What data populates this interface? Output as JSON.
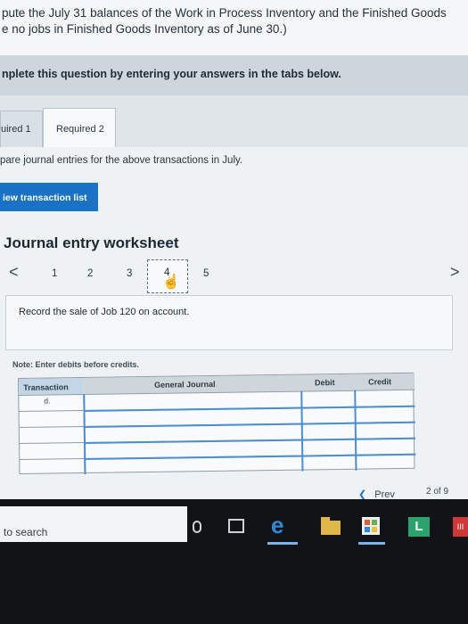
{
  "question": {
    "line1": "pute the July 31 balances of the Work in Process Inventory and the Finished Goods",
    "line2": "e no jobs in Finished Goods Inventory as of June 30.)"
  },
  "instructions": "nplete this question by entering your answers in the tabs below.",
  "tabs": [
    {
      "label": "uired 1"
    },
    {
      "label": "Required 2"
    }
  ],
  "prepare_text": "pare journal entries for the above transactions in July.",
  "view_transactions_button": "iew transaction list",
  "worksheet": {
    "title": "Journal entry worksheet",
    "prev_arrow": "<",
    "next_arrow": ">",
    "pages": [
      "1",
      "2",
      "3",
      "4",
      "5"
    ],
    "active_page": "4",
    "prompt": "Record the sale of Job 120 on account.",
    "note": "Note: Enter debits before credits.",
    "columns": {
      "transaction": "Transaction",
      "general_journal": "General Journal",
      "debit": "Debit",
      "credit": "Credit"
    },
    "rows": [
      {
        "transaction": "d.",
        "account": "",
        "debit": "",
        "credit": ""
      },
      {
        "transaction": "",
        "account": "",
        "debit": "",
        "credit": ""
      },
      {
        "transaction": "",
        "account": "",
        "debit": "",
        "credit": ""
      },
      {
        "transaction": "",
        "account": "",
        "debit": "",
        "credit": ""
      },
      {
        "transaction": "",
        "account": "",
        "debit": "",
        "credit": ""
      }
    ]
  },
  "footer": {
    "prev_label": "Prev",
    "page_indicator": "2 of 9"
  },
  "taskbar": {
    "search_text": "to search",
    "icons": [
      "microphone-icon",
      "task-view-icon",
      "edge-browser-icon",
      "file-explorer-icon",
      "store-icon",
      "app-l-icon",
      "app-red-icon"
    ],
    "edge_glyph": "e",
    "l_app_glyph": "L",
    "red_app_glyph": "III"
  },
  "colors": {
    "accent_button": "#1a72c7",
    "taskbar": "#111316",
    "edge": "#2a8ad8",
    "green_app": "#2aa36c",
    "red_app": "#d03838"
  }
}
